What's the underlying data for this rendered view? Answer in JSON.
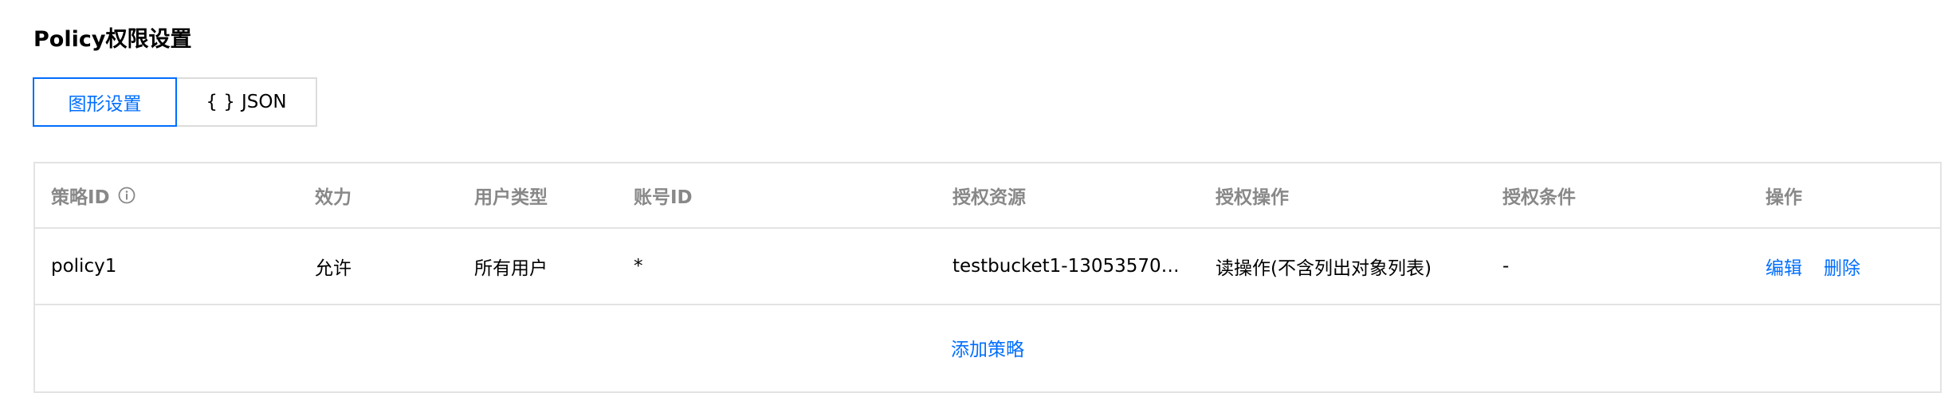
{
  "section": {
    "title": "Policy权限设置"
  },
  "mode_tabs": {
    "graphic_label": "图形设置",
    "json_braces": "{ }",
    "json_label": "JSON"
  },
  "table": {
    "headers": [
      "策略ID",
      "效力",
      "用户类型",
      "账号ID",
      "授权资源",
      "授权操作",
      "授权条件",
      "操作"
    ],
    "rows": [
      {
        "policy_id": "policy1",
        "effect": "允许",
        "user_type": "所有用户",
        "account_id": "*",
        "resource": "testbucket1-130535700…",
        "operation": "读操作(不含列出对象列表)",
        "condition": "-",
        "actions": {
          "edit": "编辑",
          "delete": "删除"
        }
      }
    ],
    "add_label": "添加策略"
  },
  "colors": {
    "accent": "#006eff",
    "header_text": "#888888",
    "border": "#e3e3e3"
  },
  "icons": {
    "header_info": "info-circle-icon"
  }
}
